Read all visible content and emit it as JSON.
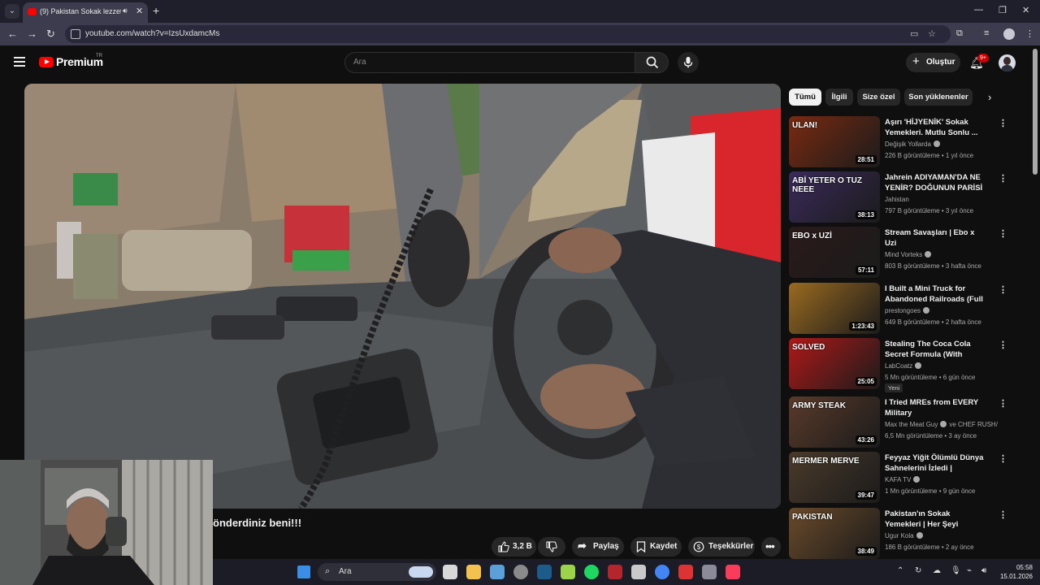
{
  "browser": {
    "tab_title": "(9) Pakistan Sokak lezzetleri",
    "url": "youtube.com/watch?v=IzsUxdamcMs"
  },
  "header": {
    "logo_text": "Premium",
    "country_code": "TR",
    "search_placeholder": "Ara",
    "create_label": "Oluştur",
    "notif_count": "9+"
  },
  "video": {
    "title": "önderdiniz beni!!!",
    "like_count": "3,2 B",
    "share_label": "Paylaş",
    "save_label": "Kaydet",
    "thanks_label": "Teşekkürler"
  },
  "chips": [
    "Tümü",
    "İlgili",
    "Size özel",
    "Son yüklenenler"
  ],
  "recommendations": [
    {
      "title": "Aşırı 'HİJYENİK' Sokak Yemekleri. Mutlu Sonlu ...",
      "channel": "Değişik Yollarda",
      "verified": true,
      "meta": "226 B görüntüleme • 1 yıl önce",
      "duration": "28:51",
      "thumb_text": "ULAN!",
      "thumb_color": "#7a2a10"
    },
    {
      "title": "Jahrein ADIYAMAN'DA NE YENİR? DOĞUNUN PARİSİ ...",
      "channel": "Jahistan",
      "verified": false,
      "meta": "797 B görüntüleme • 3 yıl önce",
      "duration": "38:13",
      "thumb_text": "ABİ YETER O TUZ NEEE",
      "thumb_color": "#3a2a5a"
    },
    {
      "title": "Stream Savaşları | Ebo x Uzi",
      "channel": "Mind Vorteks",
      "verified": true,
      "meta": "803 B görüntüleme • 3 hafta önce",
      "duration": "57:11",
      "thumb_text": "EBO x UZİ",
      "thumb_color": "#2a1a1a"
    },
    {
      "title": "I Built a Mini Truck for Abandoned Railroads (Full ...",
      "channel": "prestongoes",
      "verified": true,
      "meta": "649 B görüntüleme • 2 hafta önce",
      "duration": "1:23:43",
      "thumb_text": "",
      "thumb_color": "#9a6a20"
    },
    {
      "title": "Stealing The Coca Cola Secret Formula (With Science)",
      "channel": "LabCoatz",
      "verified": true,
      "meta": "5 Mn görüntüleme • 6 gün önce",
      "duration": "25:05",
      "thumb_text": "SOLVED",
      "thumb_color": "#b01818",
      "is_new": true,
      "new_label": "Yeni"
    },
    {
      "title": "I Tried MREs from EVERY Military",
      "channel": "Max the Meat Guy",
      "channel_extra": "ve CHEF RUSH/ S...",
      "verified": true,
      "meta": "6,5 Mn görüntüleme • 3 ay önce",
      "duration": "43:26",
      "thumb_text": "ARMY STEAK",
      "thumb_color": "#5a3a2a"
    },
    {
      "title": "Feyyaz Yiğit Ölümlü Dünya Sahnelerini İzledi | Fenomen ...",
      "channel": "KAFA TV",
      "verified": true,
      "meta": "1 Mn görüntüleme • 9 gün önce",
      "duration": "39:47",
      "thumb_text": "MERMER MERVE",
      "thumb_color": "#4a3a2a"
    },
    {
      "title": "Pakistan'ın Sokak Yemekleri | Her Şeyi Yedim!",
      "title_suffix": "PK",
      "channel": "Ugur Kola",
      "verified": true,
      "meta": "186 B görüntüleme • 2 ay önce",
      "duration": "38:49",
      "thumb_text": "PAKISTAN",
      "thumb_color": "#6a4a2a"
    }
  ],
  "taskbar": {
    "search_label": "Ara",
    "time": "05:58",
    "date": "15.01.2026"
  }
}
